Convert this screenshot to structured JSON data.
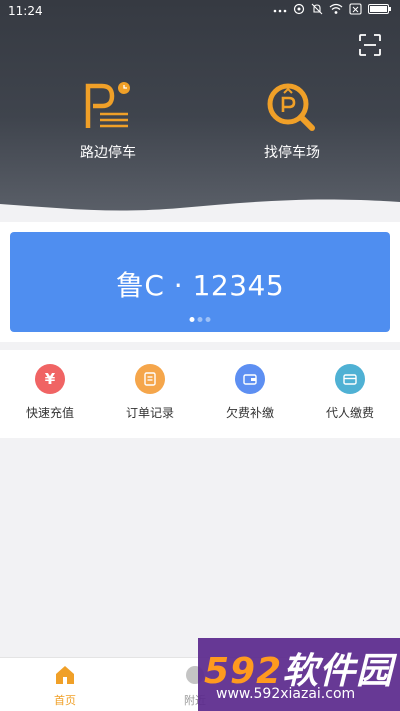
{
  "status_bar": {
    "time": "11:24"
  },
  "header": {
    "features": [
      {
        "label": "路边停车",
        "icon": "street-parking-icon"
      },
      {
        "label": "找停车场",
        "icon": "find-parking-lot-icon"
      }
    ],
    "scan_icon": "scan-icon"
  },
  "plate": {
    "number": "鲁C · 12345",
    "page_indicator": {
      "count": 3,
      "active": 1
    }
  },
  "quick_actions": [
    {
      "label": "快速充值",
      "icon": "yen-icon",
      "color": "#f06464"
    },
    {
      "label": "订单记录",
      "icon": "list-icon",
      "color": "#f5a64b"
    },
    {
      "label": "欠费补缴",
      "icon": "wallet-icon",
      "color": "#5d8ff2"
    },
    {
      "label": "代人缴费",
      "icon": "card-icon",
      "color": "#4fb1d4"
    }
  ],
  "bottom_nav": {
    "items": [
      {
        "label": "首页",
        "active": true
      },
      {
        "label": "附近",
        "active": false
      }
    ]
  },
  "colors": {
    "accent": "#f0a028",
    "plate_blue": "#4f8ef0",
    "header_dark": "#3a3e46"
  },
  "watermark": {
    "brand_num": "592",
    "brand_text": "软件园",
    "url": "www.592xiazai.com"
  }
}
